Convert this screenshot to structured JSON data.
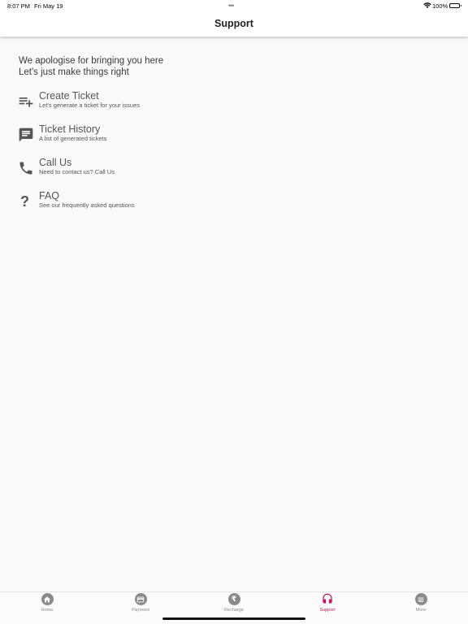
{
  "status_bar": {
    "time": "8:07 PM",
    "date": "Fri May 19",
    "dots": "•••",
    "battery_pct": "100%"
  },
  "header": {
    "title": "Support"
  },
  "intro": {
    "line1": "We apologise for bringing you here",
    "line2": "Let's just make things right"
  },
  "items": [
    {
      "title": "Create Ticket",
      "subtitle": "Let's generate a ticket for your issues",
      "icon": "playlist-add-icon"
    },
    {
      "title": "Ticket History",
      "subtitle": "A list of generated tickets",
      "icon": "chat-message-icon"
    },
    {
      "title": "Call Us",
      "subtitle": "Need to contact us? Call Us",
      "icon": "phone-icon"
    },
    {
      "title": "FAQ",
      "subtitle": "See our frequently asked questions",
      "icon": "question-mark-icon",
      "glyph": "?"
    }
  ],
  "tabs": [
    {
      "label": "Home",
      "icon": "home-icon"
    },
    {
      "label": "Payment",
      "icon": "card-icon"
    },
    {
      "label": "Recharge",
      "icon": "rupee-icon",
      "glyph": "₹"
    },
    {
      "label": "Support",
      "icon": "headphones-icon",
      "active": true
    },
    {
      "label": "More",
      "icon": "menu-icon"
    }
  ],
  "colors": {
    "accent": "#c2185b",
    "inactive_tab": "#8a8a8a",
    "icon": "#555555",
    "background": "#f9f9f9"
  }
}
